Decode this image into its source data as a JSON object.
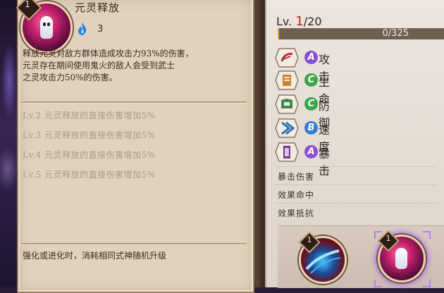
{
  "skill": {
    "level_badge": "1",
    "name": "元灵释放",
    "fire_cost": "3",
    "description_lines": [
      "释放元灵对敌方群体造成攻击力93%的伤害，",
      "元灵存在期间使用鬼火的敌人会受到武士",
      "之灵攻击力50%的伤害。"
    ],
    "upgrades": [
      "Lv.2  元灵释放的直接伤害增加5%",
      "Lv.3  元灵释放的直接伤害增加5%",
      "Lv.4  元灵释放的直接伤害增加5%",
      "Lv.5  元灵释放的直接伤害增加5%"
    ],
    "footer": "强化或进化时，消耗相同式神随机升级"
  },
  "stats": {
    "lv_prefix": "Lv.",
    "lv_current": "1",
    "lv_max": "/20",
    "xp_text": "0/325",
    "xp_fraction": 0.01,
    "rows": [
      {
        "grade": "A",
        "label": "攻击",
        "grade_color": "#8a4fd6",
        "icon": "attack-icon"
      },
      {
        "grade": "C",
        "label": "生命",
        "grade_color": "#3aa84a",
        "icon": "health-icon"
      },
      {
        "grade": "C",
        "label": "防御",
        "grade_color": "#3aa84a",
        "icon": "defense-icon"
      },
      {
        "grade": "B",
        "label": "速度",
        "grade_color": "#2f7fd6",
        "icon": "speed-icon"
      },
      {
        "grade": "A",
        "label": "暴击",
        "grade_color": "#8a4fd6",
        "icon": "crit-icon"
      }
    ],
    "sub_stats": [
      "暴击伤害",
      "效果命中",
      "效果抵抗"
    ]
  },
  "slots": {
    "slot1_badge": "1",
    "slot2_badge": "1"
  },
  "colors": {
    "panel_bg": "#e0d2bd",
    "level_red": "#b7261d",
    "xp_fill": "#e0a53b",
    "selected_glow": "#a65bff"
  }
}
